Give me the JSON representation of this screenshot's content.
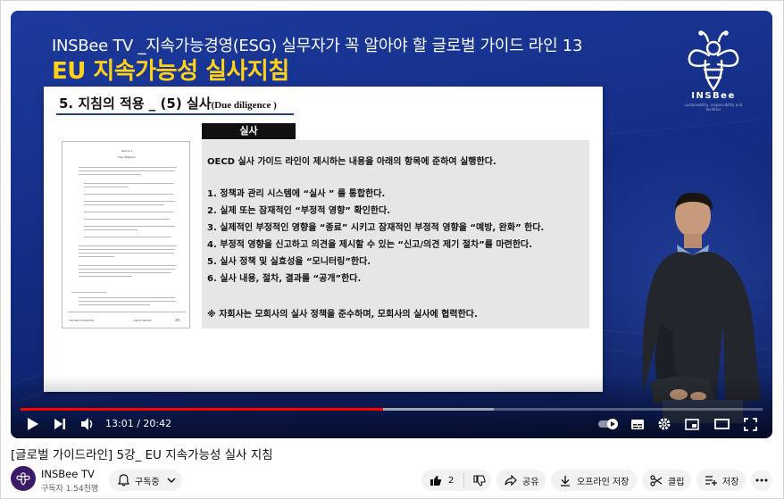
{
  "video": {
    "heading_top": "INSBee TV _지속가능경영(ESG) 실무자가 꼭 알아야 할 글로벌 가이드 라인 13",
    "heading_main": "EU 지속가능성 실사지침",
    "logo": {
      "name": "INSBee",
      "sub": "sustainability, responsibility and facilities"
    },
    "slide": {
      "heading": "5. 지침의 적용 _ (5) 실사",
      "heading_small": "(Due diligence )",
      "badge": "실사",
      "intro": "OECD 실사 가이드 라인이 제시하는 내용을 아래의 항목에 준하여 실행한다.",
      "items": [
        "1.   정책과 관리 시스템에 “실사 ” 를 통합한다.",
        "2.   실제 또는 잠재적인 “부정적 영향” 확인한다.",
        "3.   실제적인 부정적인 영향을 “종료” 시키고 잠재적인 부정적 영향을 “예방, 완화” 한다.",
        "4.   부정적 영향을 신고하고 의견을 제시할 수 있는 “신고/의견 제기 절차”를 마련한다.",
        "5.   실사 정책 및 실효성을 “모니터링”한다.",
        "6.   실사 내용, 절차, 결과를 “공개”한다."
      ],
      "note": "※ 자회사는 모회사의 실사 정책을 준수하며, 모회사의 실사에 협력한다.",
      "document": {
        "article": "Article 4",
        "subject": "Due diligence",
        "footer_left": "PE/06/CJ/XXX/EN",
        "footer_mid": "PE/07/AP/EN",
        "footer_num": "2N"
      }
    },
    "player": {
      "time_current": "13:01",
      "time_total": "20:42",
      "time_separator": " / ",
      "progress_played": 0.488,
      "progress_buffered": 0.638,
      "autoplay_on": true
    }
  },
  "info": {
    "title": "[글로벌 가이드라인] 5강_ EU 지속가능성 실사 지침",
    "channel": "INSBee TV",
    "subscribers": "구독자 1.54천명",
    "avatar_text": "INSBee",
    "subscribe_label": "구독중",
    "like_count": "2",
    "share_label": "공유",
    "offline_label": "오프라인 저장",
    "clip_label": "클립",
    "save_label": "저장"
  },
  "colors": {
    "background_blue": "#16308a",
    "title_yellow": "#ffd21a",
    "progress_red": "#ff0000",
    "pill_gray": "#f2f2f2"
  },
  "icons": [
    "play-icon",
    "next-icon",
    "volume-icon",
    "autoplay-toggle-icon",
    "subtitles-icon",
    "settings-icon",
    "miniplayer-icon",
    "theater-icon",
    "fullscreen-icon",
    "bell-icon",
    "chevron-down-icon",
    "like-icon",
    "dislike-icon",
    "share-icon",
    "download-icon",
    "scissors-icon",
    "playlist-add-icon",
    "more-icon"
  ]
}
